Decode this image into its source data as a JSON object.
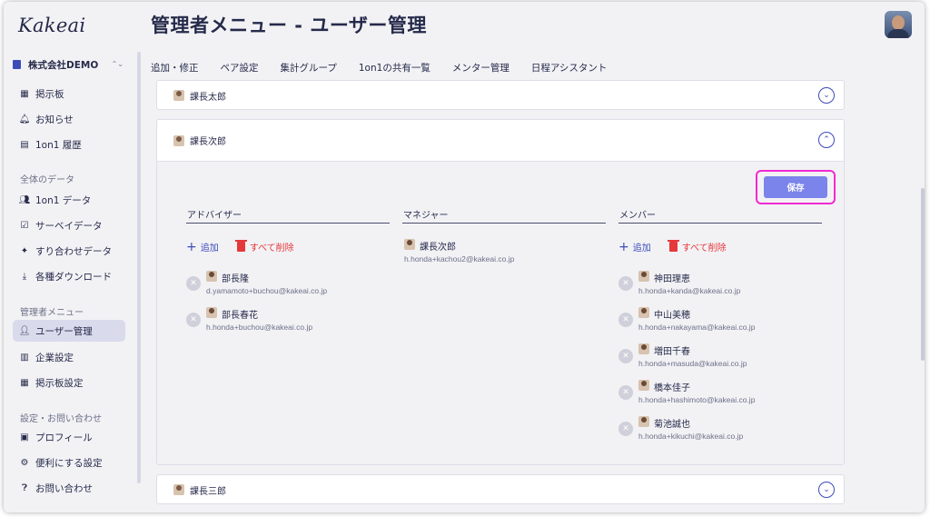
{
  "app": {
    "logo": "Kakeai",
    "page_title": "管理者メニュー - ユーザー管理"
  },
  "sidebar": {
    "company": "株式会社DEMO",
    "updown": "⌃⌄",
    "top_items": [
      {
        "label": "掲示板",
        "icon": "board-icon"
      },
      {
        "label": "お知らせ",
        "icon": "bell-icon"
      },
      {
        "label": "1on1 履歴",
        "icon": "history-icon"
      }
    ],
    "sections": [
      {
        "title": "全体のデータ",
        "items": [
          {
            "label": "1on1 データ",
            "icon": "people-icon"
          },
          {
            "label": "サーベイデータ",
            "icon": "survey-icon"
          },
          {
            "label": "すり合わせデータ",
            "icon": "puzzle-icon"
          },
          {
            "label": "各種ダウンロード",
            "icon": "download-icon"
          }
        ]
      },
      {
        "title": "管理者メニュー",
        "items": [
          {
            "label": "ユーザー管理",
            "icon": "user-manage-icon",
            "active": true
          },
          {
            "label": "企業設定",
            "icon": "company-icon"
          },
          {
            "label": "掲示板設定",
            "icon": "board-settings-icon"
          }
        ]
      },
      {
        "title": "設定・お問い合わせ",
        "items": [
          {
            "label": "プロフィール",
            "icon": "profile-icon"
          },
          {
            "label": "便利にする設定",
            "icon": "gear-icon"
          },
          {
            "label": "お問い合わせ",
            "icon": "help-icon"
          }
        ]
      }
    ]
  },
  "tabs": [
    {
      "label": "追加・修正",
      "active": false
    },
    {
      "label": "ペア設定",
      "active": true
    },
    {
      "label": "集計グループ",
      "active": false
    },
    {
      "label": "1on1の共有一覧",
      "active": false
    },
    {
      "label": "メンター管理",
      "active": false
    },
    {
      "label": "日程アシスタント",
      "active": false
    }
  ],
  "cards": {
    "card1": {
      "title": "課長太郎",
      "expanded": false
    },
    "card2": {
      "title": "課長次郎",
      "expanded": true
    },
    "card3": {
      "title": "課長三郎",
      "expanded": false
    }
  },
  "pair": {
    "save_label": "保存",
    "add_label": "追加",
    "delete_all_label": "すべて削除",
    "remove_glyph": "✕",
    "advisor": {
      "title": "アドバイザー",
      "members": [
        {
          "name": "部長隆",
          "email": "d.yamamoto+buchou@kakeai.co.jp"
        },
        {
          "name": "部長春花",
          "email": "h.honda+buchou@kakeai.co.jp"
        }
      ]
    },
    "manager": {
      "title": "マネジャー",
      "name": "課長次郎",
      "email": "h.honda+kachou2@kakeai.co.jp"
    },
    "member": {
      "title": "メンバー",
      "members": [
        {
          "name": "神田理恵",
          "email": "h.honda+kanda@kakeai.co.jp"
        },
        {
          "name": "中山美穂",
          "email": "h.honda+nakayama@kakeai.co.jp"
        },
        {
          "name": "増田千春",
          "email": "h.honda+masuda@kakeai.co.jp"
        },
        {
          "name": "橋本佳子",
          "email": "h.honda+hashimoto@kakeai.co.jp"
        },
        {
          "name": "菊池誠也",
          "email": "h.honda+kikuchi@kakeai.co.jp"
        }
      ]
    }
  },
  "icons": {
    "chevron_down": "⌄",
    "chevron_up": "⌃",
    "plus": "+"
  },
  "colors": {
    "accent": "#3b4cb8",
    "save_button": "#7a84ea",
    "highlight": "#f02ad2",
    "delete": "#e5383b"
  }
}
